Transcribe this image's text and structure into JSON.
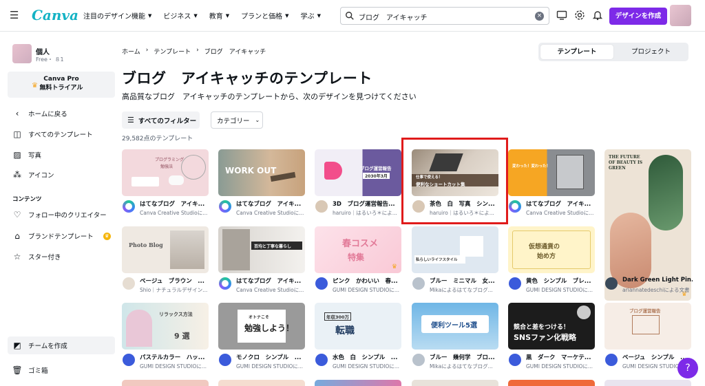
{
  "topbar": {
    "logo": "Canva",
    "nav": [
      "注目のデザイン機能",
      "ビジネス",
      "教育",
      "プランと価格",
      "学ぶ"
    ],
    "search_value": "ブログ　アイキャッチ",
    "create_button": "デザインを作成"
  },
  "sidebar": {
    "account_name": "個人",
    "account_sub": "Free・  ８1",
    "pro_line1": "Canva Pro",
    "pro_line2": "無料トライアル",
    "items": {
      "home": "ホームに戻る",
      "all_templates": "すべてのテンプレート",
      "photos": "写真",
      "icons": "アイコン",
      "content_head": "コンテンツ",
      "following": "フォロー中のクリエイター",
      "brand": "ブランドテンプレート",
      "starred": "スター付き",
      "team": "チームを作成",
      "trash": "ゴミ箱"
    }
  },
  "main": {
    "breadcrumb": [
      "ホーム",
      "テンプレート",
      "ブログ　アイキャッチ"
    ],
    "seg_templates": "テンプレート",
    "seg_projects": "プロジェクト",
    "title": "ブログ　アイキャッチのテンプレート",
    "subtitle": "高品質なブログ　アイキャッチのテンプレートから、次のデザインを見つけてください",
    "filter_button": "すべてのフィルター",
    "category_button": "カテゴリー",
    "count": "29,582点のテンプレート"
  },
  "cards": [
    {
      "title": "はてなブログ　アイキ...",
      "author": "Canva Creative Studioに..."
    },
    {
      "title": "はてなブログ　アイキ...",
      "author": "Canva Creative Studioに..."
    },
    {
      "title": "3D　ブログ運営報告...",
      "author": "haruiro｜はるいろ＊によ..."
    },
    {
      "title": "茶色　白　写真　シン...",
      "author": "haruiro｜はるいろ＊によ..."
    },
    {
      "title": "はてなブログ　アイキ...",
      "author": "Canva Creative Studioに..."
    },
    {
      "title": "Dark Green Light Pin...",
      "author": "ariannatedeschiによる文書"
    },
    {
      "title": "ベージュ　ブラウン　...",
      "author": "Shio｜ナチュラルデザイン..."
    },
    {
      "title": "はてなブログ　アイキ...",
      "author": "Canva Creative Studioに..."
    },
    {
      "title": "ピンク　かわいい　春...",
      "author": "GUMI DESIGN STUDIOに..."
    },
    {
      "title": "ブルー　ミニマル　女...",
      "author": "Mikaによるはてなブログ..."
    },
    {
      "title": "黄色　シンプル　ブレ...",
      "author": "GUMI DESIGN STUDIOに..."
    },
    {
      "title": "パステルカラー　ハッ...",
      "author": "GUMI DESIGN STUDIOに..."
    },
    {
      "title": "モノクロ　シンプル　...",
      "author": "GUMI DESIGN STUDIOに..."
    },
    {
      "title": "水色　白　シンプル　...",
      "author": "GUMI DESIGN STUDIOに..."
    },
    {
      "title": "ブルー　幾何学　ブロ...",
      "author": "Mikaによるはてなブログ..."
    },
    {
      "title": "黒　ダーク　マーケテ...",
      "author": "GUMI DESIGN STUDIOに..."
    },
    {
      "title": "ベージュ　シンプル　...",
      "author": "GUMI DESIGN STUDIOに..."
    }
  ],
  "thumb_text": {
    "t1a": "プログラミング",
    "t1b": "勉強法",
    "t2": "WORK OUT",
    "t3a": "ブログ運営報告",
    "t3b": "2030年3月",
    "t4a": "仕事で使える！",
    "t4b": "便利なショートカット集",
    "t5": "変わった！変わった！",
    "t6a": "THE FUTURE",
    "t6b": "OF BEAUTY IS",
    "t6c": "GREEN",
    "t7": "Photo Blog",
    "t8": "百均と丁寧な暮らし",
    "t9a": "春コスメ",
    "t9b": "特集",
    "t10": "私らしいライフスタイル",
    "t11a": "仮想通貨の",
    "t11b": "始め方",
    "t12a": "リラックス方法",
    "t12b": "9 選",
    "t13a": "オトナこそ",
    "t13b": "勉強しよう！",
    "t14a": "年収300万",
    "t14b": "転職",
    "t15a": "便利ツール5選",
    "t16a": "競合と差をつける！",
    "t16b": "SNSファン化戦略",
    "t17": "ブログ運営報告"
  },
  "help": "?"
}
